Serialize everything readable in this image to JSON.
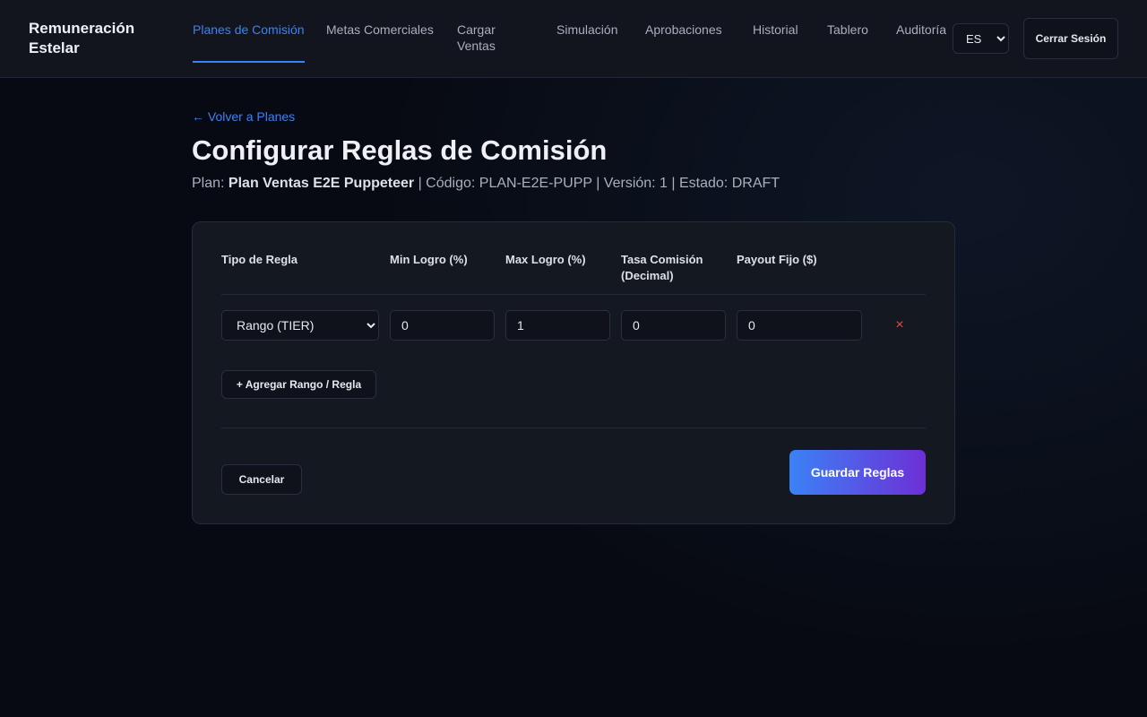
{
  "header": {
    "brand": "Remuneración Estelar",
    "nav": [
      {
        "label": "Planes de Comisión",
        "active": true
      },
      {
        "label": "Metas Comerciales"
      },
      {
        "label": "Cargar Ventas"
      },
      {
        "label": "Simulación"
      },
      {
        "label": "Aprobaciones"
      },
      {
        "label": "Historial"
      },
      {
        "label": "Tablero"
      },
      {
        "label": "Auditoría"
      }
    ],
    "language": "ES",
    "logout_label": "Cerrar Sesión"
  },
  "page": {
    "back_link": "← Volver a Planes",
    "title": "Configurar Reglas de Comisión",
    "meta": {
      "plan_prefix": "Plan:",
      "plan_name": "Plan Ventas E2E Puppeteer",
      "rest": "| Código: PLAN-E2E-PUPP | Versión: 1 | Estado: DRAFT"
    }
  },
  "rules_table": {
    "columns": [
      "Tipo de Regla",
      "Min Logro (%)",
      "Max Logro (%)",
      "Tasa Comisión (Decimal)",
      "Payout Fijo ($)"
    ],
    "rows": [
      {
        "type": "Rango (TIER)",
        "min": "0",
        "max": "1",
        "rate": "0",
        "payout": "0"
      }
    ],
    "add_label": "+ Agregar Rango / Regla",
    "remove_symbol": "×"
  },
  "actions": {
    "cancel_label": "Cancelar",
    "save_label": "Guardar Reglas"
  },
  "colors": {
    "accent": "#3b82f6",
    "danger": "#e24a4a",
    "gradient_end": "#6d2fd6"
  }
}
